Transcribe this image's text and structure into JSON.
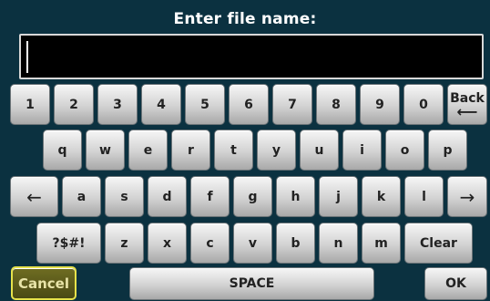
{
  "title": "Enter file name:",
  "input": {
    "value": ""
  },
  "keys": {
    "row1": [
      "1",
      "2",
      "3",
      "4",
      "5",
      "6",
      "7",
      "8",
      "9",
      "0"
    ],
    "back": "Back",
    "row2": [
      "q",
      "w",
      "e",
      "r",
      "t",
      "y",
      "u",
      "i",
      "o",
      "p"
    ],
    "left_arrow": "←",
    "row3": [
      "a",
      "s",
      "d",
      "f",
      "g",
      "h",
      "j",
      "k",
      "l"
    ],
    "right_arrow": "→",
    "symbols": "?$#!",
    "row4": [
      "z",
      "x",
      "c",
      "v",
      "b",
      "n",
      "m"
    ],
    "clear": "Clear",
    "cancel": "Cancel",
    "space": "SPACE",
    "ok": "OK"
  },
  "colors": {
    "background": "#0b3140",
    "cancel_border": "#e6e24b"
  }
}
